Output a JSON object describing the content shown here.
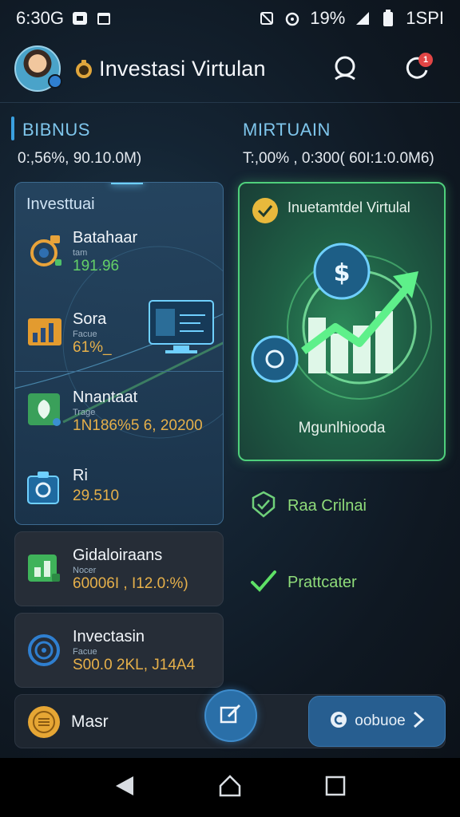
{
  "status_bar": {
    "time": "6:30G",
    "battery": "19%",
    "right_time": "1SPI"
  },
  "header": {
    "title": "Investasi Virtulan",
    "notification_count": "1"
  },
  "summary": {
    "left": {
      "title": "BIBNUS",
      "value": "0:,56%, 90.10.0M)"
    },
    "right": {
      "title": "MIRTUAIN",
      "value": "T:,00% , 0:300( 60I:1:0.0M6)"
    }
  },
  "left_panel": {
    "title": "Investtuai",
    "items": [
      {
        "name": "Batahaar",
        "sub": "tam",
        "value": "191.96",
        "color": "green",
        "icon": "gear-timer-icon"
      },
      {
        "name": "Sora",
        "sub": "Facue",
        "value": "61%_",
        "color": "gold",
        "icon": "bar-chart-icon"
      },
      {
        "name": "Nnantaat",
        "sub": "Trage",
        "value": "1N186%5 6, 20200",
        "color": "gold",
        "icon": "shield-leaf-icon"
      },
      {
        "name": "Ri",
        "sub": "",
        "value": "29.510",
        "color": "gold",
        "icon": "briefcase-icon"
      }
    ]
  },
  "cards": [
    {
      "name": "Gidaloiraans",
      "sub": "Nocer",
      "value": "60006I , I12.0:%)",
      "icon": "green-chart-icon"
    },
    {
      "name": "Invectasin",
      "sub": "Facue",
      "value": "S00.0 2KL, J14A4",
      "icon": "ring-icon"
    }
  ],
  "right_card": {
    "title": "Inuetamtdel Virtulal",
    "caption": "Mgunlhiooda"
  },
  "checks": [
    {
      "label": "Raa Crilnai"
    },
    {
      "label": "Prattcater"
    }
  ],
  "bottom_bar": {
    "label": "Masr",
    "button_label": "oobuoe"
  },
  "colors": {
    "accent_green": "#64d068",
    "accent_gold": "#e6b04a",
    "accent_blue": "#2a6fa8"
  }
}
